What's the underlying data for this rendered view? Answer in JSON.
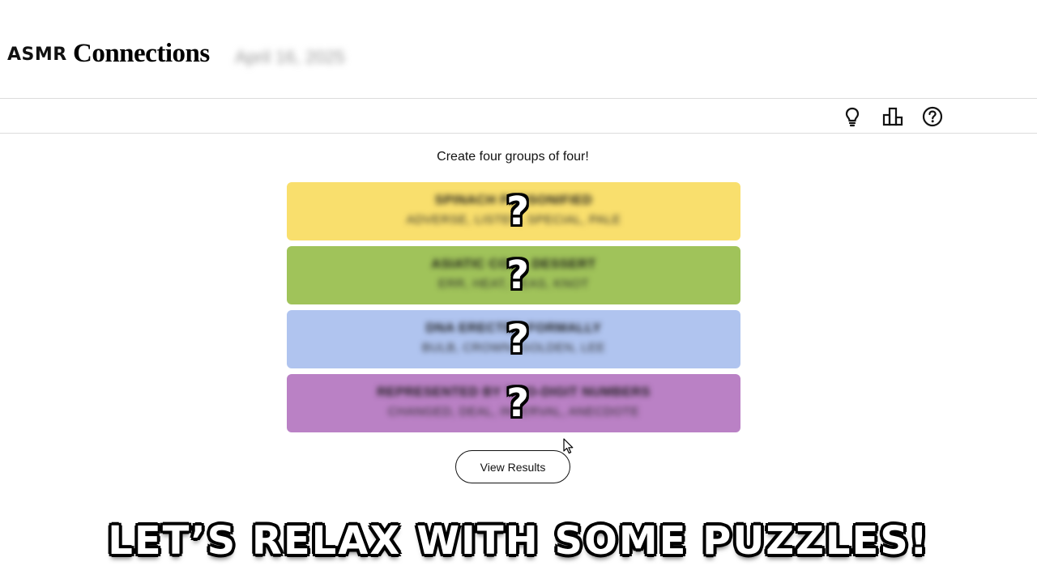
{
  "header": {
    "brand_prefix": "ASMR",
    "brand_title": "Connections",
    "date": "April 16, 2025"
  },
  "toolbar": {
    "icons": [
      "lightbulb-icon",
      "leaderboard-icon",
      "help-icon"
    ]
  },
  "main": {
    "prompt": "Create four groups of four!",
    "groups": [
      {
        "color": "#f9df6d",
        "title": "SPINACH PERSONIFIED",
        "members": "ADVERSE, LISTEN, SPECIAL, PALE",
        "mark": "?"
      },
      {
        "color": "#a0c35a",
        "title": "ASIATIC COOL DESSERT",
        "members": "ERR, HEAT, PEAS, KNOT",
        "mark": "?"
      },
      {
        "color": "#b0c4ef",
        "title": "DNA ERECTED FORMALLY",
        "members": "BULB, CROWN, GOLDEN, LEE",
        "mark": "?"
      },
      {
        "color": "#ba81c5",
        "title": "REPRESENTED BY TWO-DIGIT NUMBERS",
        "members": "CHANGED, DEAL, INTERVAL, ANECDOTE",
        "mark": "?"
      }
    ],
    "view_results_label": "View Results"
  },
  "banner": {
    "text": "LET’S RELAX WITH SOME PUZZLES!"
  }
}
